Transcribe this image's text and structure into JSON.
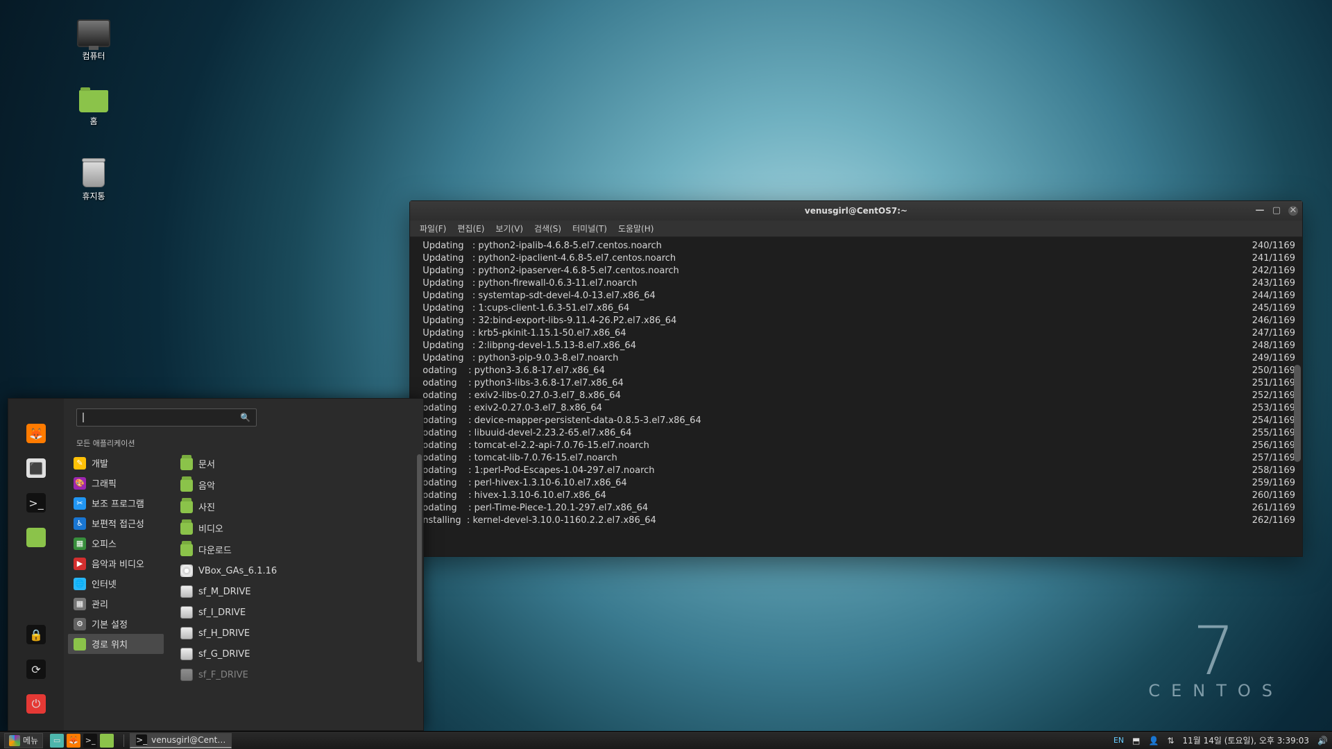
{
  "desktop": {
    "icons": [
      {
        "name": "computer-icon",
        "label": "컴퓨터"
      },
      {
        "name": "home-folder-icon",
        "label": "홈"
      },
      {
        "name": "trash-icon",
        "label": "휴지통"
      }
    ]
  },
  "branding": {
    "version": "7",
    "name": "CENTOS"
  },
  "terminal": {
    "title": "venusgirl@CentOS7:~",
    "menus": [
      "파일(F)",
      "편집(E)",
      "보기(V)",
      "검색(S)",
      "터미널(T)",
      "도움말(H)"
    ],
    "total": "1169",
    "lines": [
      {
        "action": "Updating",
        "prefix": "",
        "pkg": "python2-ipalib-4.6.8-5.el7.centos.noarch",
        "n": "240"
      },
      {
        "action": "Updating",
        "prefix": "",
        "pkg": "python2-ipaclient-4.6.8-5.el7.centos.noarch",
        "n": "241"
      },
      {
        "action": "Updating",
        "prefix": "",
        "pkg": "python2-ipaserver-4.6.8-5.el7.centos.noarch",
        "n": "242"
      },
      {
        "action": "Updating",
        "prefix": "",
        "pkg": "python-firewall-0.6.3-11.el7.noarch",
        "n": "243"
      },
      {
        "action": "Updating",
        "prefix": "",
        "pkg": "systemtap-sdt-devel-4.0-13.el7.x86_64",
        "n": "244"
      },
      {
        "action": "Updating",
        "prefix": "1:",
        "pkg": "cups-client-1.6.3-51.el7.x86_64",
        "n": "245"
      },
      {
        "action": "Updating",
        "prefix": "32:",
        "pkg": "bind-export-libs-9.11.4-26.P2.el7.x86_64",
        "n": "246"
      },
      {
        "action": "Updating",
        "prefix": "",
        "pkg": "krb5-pkinit-1.15.1-50.el7.x86_64",
        "n": "247"
      },
      {
        "action": "Updating",
        "prefix": "2:",
        "pkg": "libpng-devel-1.5.13-8.el7.x86_64",
        "n": "248"
      },
      {
        "action": "Updating",
        "prefix": "",
        "pkg": "python3-pip-9.0.3-8.el7.noarch",
        "n": "249"
      },
      {
        "action": "odating",
        "prefix": "",
        "pkg": "python3-3.6.8-17.el7.x86_64",
        "n": "250"
      },
      {
        "action": "odating",
        "prefix": "",
        "pkg": "python3-libs-3.6.8-17.el7.x86_64",
        "n": "251"
      },
      {
        "action": "odating",
        "prefix": "",
        "pkg": "exiv2-libs-0.27.0-3.el7_8.x86_64",
        "n": "252"
      },
      {
        "action": "odating",
        "prefix": "",
        "pkg": "exiv2-0.27.0-3.el7_8.x86_64",
        "n": "253"
      },
      {
        "action": "odating",
        "prefix": "",
        "pkg": "device-mapper-persistent-data-0.8.5-3.el7.x86_64",
        "n": "254"
      },
      {
        "action": "odating",
        "prefix": "",
        "pkg": "libuuid-devel-2.23.2-65.el7.x86_64",
        "n": "255"
      },
      {
        "action": "odating",
        "prefix": "",
        "pkg": "tomcat-el-2.2-api-7.0.76-15.el7.noarch",
        "n": "256"
      },
      {
        "action": "odating",
        "prefix": "",
        "pkg": "tomcat-lib-7.0.76-15.el7.noarch",
        "n": "257"
      },
      {
        "action": "odating",
        "prefix": "1:",
        "pkg": "perl-Pod-Escapes-1.04-297.el7.noarch",
        "n": "258"
      },
      {
        "action": "odating",
        "prefix": "",
        "pkg": "perl-hivex-1.3.10-6.10.el7.x86_64",
        "n": "259"
      },
      {
        "action": "odating",
        "prefix": "",
        "pkg": "hivex-1.3.10-6.10.el7.x86_64",
        "n": "260"
      },
      {
        "action": "odating",
        "prefix": "",
        "pkg": "perl-Time-Piece-1.20.1-297.el7.x86_64",
        "n": "261"
      },
      {
        "action": "nstalling",
        "prefix": "",
        "pkg": "kernel-devel-3.10.0-1160.2.2.el7.x86_64",
        "n": "262"
      }
    ]
  },
  "menu": {
    "search_placeholder": "",
    "all_apps_label": "모든 애플리케이션",
    "favorites": {
      "top": [
        {
          "name": "firefox-icon",
          "bg": "#ff7b00",
          "glyph": "🦊"
        },
        {
          "name": "system-software-icon",
          "bg": "#e0e0e0",
          "glyph": "⬛"
        },
        {
          "name": "terminal-icon",
          "bg": "#111",
          "glyph": ">_"
        },
        {
          "name": "files-icon",
          "bg": "#8bc34a",
          "glyph": ""
        }
      ],
      "bottom": [
        {
          "name": "lock-screen-icon",
          "bg": "#111",
          "glyph": "🔒"
        },
        {
          "name": "logout-icon",
          "bg": "#111",
          "glyph": "⟳"
        },
        {
          "name": "power-icon",
          "bg": "#e53935",
          "glyph": "⏻"
        }
      ]
    },
    "categories": [
      {
        "label": "개발",
        "color": "#ffc107",
        "glyph": "✎"
      },
      {
        "label": "그래픽",
        "color": "#9c27b0",
        "glyph": "🎨"
      },
      {
        "label": "보조 프로그램",
        "color": "#2196f3",
        "glyph": "✂"
      },
      {
        "label": "보편적 접근성",
        "color": "#1976d2",
        "glyph": "♿"
      },
      {
        "label": "오피스",
        "color": "#388e3c",
        "glyph": "▦"
      },
      {
        "label": "음악과 비디오",
        "color": "#d32f2f",
        "glyph": "▶"
      },
      {
        "label": "인터넷",
        "color": "#29b6f6",
        "glyph": "🌐"
      },
      {
        "label": "관리",
        "color": "#757575",
        "glyph": "▦"
      },
      {
        "label": "기본 설정",
        "color": "#616161",
        "glyph": "⚙"
      },
      {
        "label": "경로 위치",
        "color": "#8bc34a",
        "glyph": "",
        "selected": true
      }
    ],
    "places": [
      {
        "type": "folder",
        "label": "문서"
      },
      {
        "type": "folder",
        "label": "음악"
      },
      {
        "type": "folder",
        "label": "사진"
      },
      {
        "type": "folder",
        "label": "비디오"
      },
      {
        "type": "folder",
        "label": "다운로드"
      },
      {
        "type": "disc",
        "label": "VBox_GAs_6.1.16"
      },
      {
        "type": "drive",
        "label": "sf_M_DRIVE"
      },
      {
        "type": "drive",
        "label": "sf_I_DRIVE"
      },
      {
        "type": "drive",
        "label": "sf_H_DRIVE"
      },
      {
        "type": "drive",
        "label": "sf_G_DRIVE"
      },
      {
        "type": "drive",
        "label": "sf_F_DRIVE",
        "dim": true
      }
    ]
  },
  "panel": {
    "menu_label": "메뉴",
    "tasks": [
      {
        "name": "terminal-task",
        "label": "venusgirl@Cent…",
        "icon_glyph": ">_",
        "icon_bg": "#111",
        "active": true
      }
    ],
    "launchers": [
      {
        "name": "show-desktop-icon",
        "bg": "#4db6ac",
        "glyph": "▭"
      },
      {
        "name": "firefox-launcher-icon",
        "bg": "#ff7b00",
        "glyph": "🦊"
      },
      {
        "name": "terminal-launcher-icon",
        "bg": "#111",
        "glyph": ">_"
      },
      {
        "name": "files-launcher-icon",
        "bg": "#8bc34a",
        "glyph": ""
      }
    ],
    "tray": {
      "lang": "EN",
      "datetime": "11월 14일 (토요일), 오후 3:39:03"
    }
  }
}
